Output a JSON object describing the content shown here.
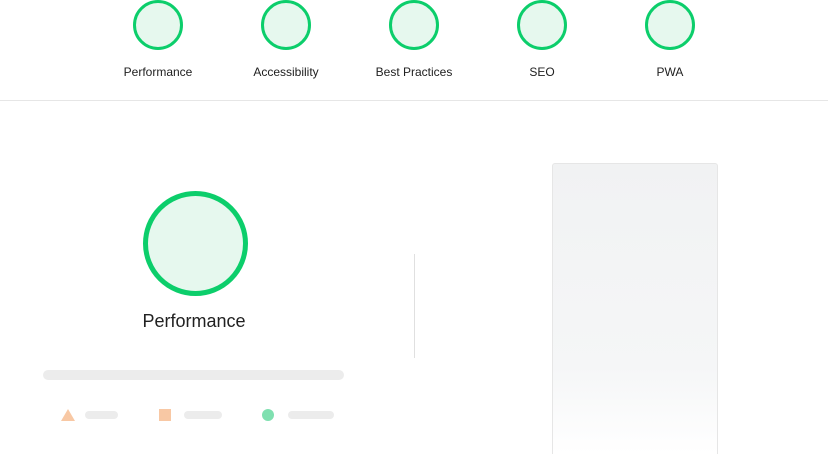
{
  "categories": [
    {
      "label": "Performance"
    },
    {
      "label": "Accessibility"
    },
    {
      "label": "Best Practices"
    },
    {
      "label": "SEO"
    },
    {
      "label": "PWA"
    }
  ],
  "main_gauge": {
    "title": "Performance"
  },
  "legend": [
    {
      "icon": "triangle-icon",
      "color": "#f8c8a4"
    },
    {
      "icon": "square-icon",
      "color": "#f8c8a4"
    },
    {
      "icon": "circle-icon",
      "color": "#7fe0b0"
    }
  ],
  "colors": {
    "gauge_stroke": "#0cce6b",
    "gauge_fill": "#e6f8ee",
    "skeleton": "#ececec"
  }
}
